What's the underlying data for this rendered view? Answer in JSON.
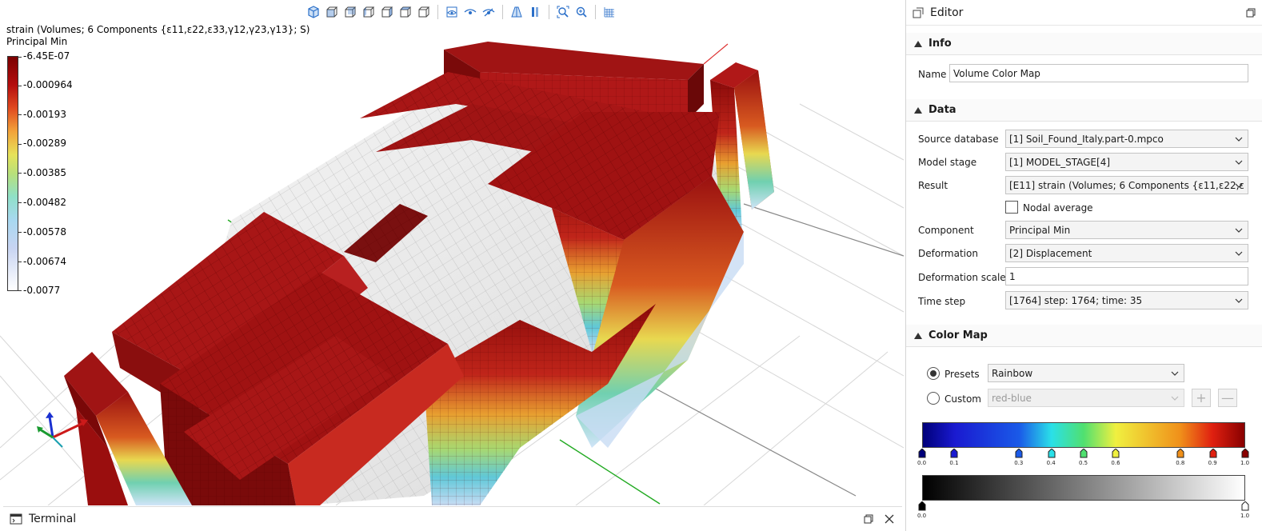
{
  "toolbar": {
    "icons": [
      "iso-view-icon",
      "front-view-icon",
      "back-view-icon",
      "left-view-icon",
      "right-view-icon",
      "top-view-icon",
      "bottom-view-icon",
      "show-icon",
      "eye-icon",
      "hide-icon",
      "perspective-icon",
      "parallel-icon",
      "zoom-fit-icon",
      "zoom-icon",
      "grid-icon"
    ]
  },
  "legend": {
    "title": "strain (Volumes; 6 Components {ε11,ε22,ε33,γ12,γ23,γ13}; S)",
    "component": "Principal Min",
    "labels": [
      "-6.45E-07",
      "-0.000964",
      "-0.00193",
      "-0.00289",
      "-0.00385",
      "-0.00482",
      "-0.00578",
      "-0.00674",
      "-0.0077"
    ]
  },
  "terminal": {
    "title": "Terminal"
  },
  "editor": {
    "title": "Editor",
    "info": {
      "header": "Info",
      "name_label": "Name",
      "name_value": "Volume Color Map"
    },
    "data": {
      "header": "Data",
      "source_label": "Source database",
      "source_value": "[1] Soil_Found_Italy.part-0.mpco",
      "stage_label": "Model stage",
      "stage_value": "[1] MODEL_STAGE[4]",
      "result_label": "Result",
      "result_value": "[E11] strain (Volumes; 6 Components {ε11,ε22,ε",
      "nodal_label": "Nodal average",
      "nodal_checked": false,
      "component_label": "Component",
      "component_value": "Principal Min",
      "deformation_label": "Deformation",
      "deformation_value": "[2] Displacement",
      "scale_label": "Deformation scale",
      "scale_value": "1",
      "timestep_label": "Time step",
      "timestep_value": "[1764] step: 1764; time: 35"
    },
    "colormap": {
      "header": "Color Map",
      "presets_label": "Presets",
      "presets_value": "Rainbow",
      "custom_label": "Custom",
      "custom_value": "red-blue",
      "add_symbol": "+",
      "remove_symbol": "—",
      "rainbow_stops": [
        "0.0",
        "0.1",
        "0.3",
        "0.4",
        "0.5",
        "0.6",
        "0.8",
        "0.9",
        "1.0"
      ],
      "rainbow_stop_colors": [
        "#00007a",
        "#1a1ad0",
        "#1a5ae8",
        "#2ae0e8",
        "#50e070",
        "#f0f040",
        "#f0901a",
        "#e02010",
        "#880000"
      ],
      "gray_stops": [
        "0.0",
        "1.0"
      ]
    }
  }
}
